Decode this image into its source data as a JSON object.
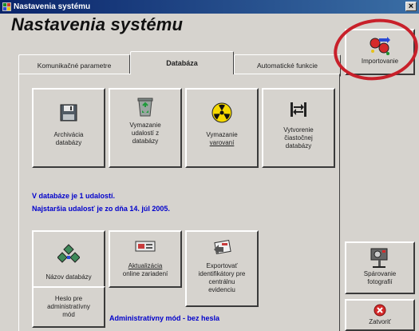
{
  "window": {
    "title": "Nastavenia systému",
    "heading": "Nastavenia systému",
    "close_glyph": "×"
  },
  "tabs": [
    {
      "label": "Komunikačné parametre",
      "active": false
    },
    {
      "label": "Databáza",
      "active": true
    },
    {
      "label": "Automatické funkcie",
      "active": false
    }
  ],
  "actions_top": [
    {
      "label_line1": "Archivácia",
      "label_line2": "databázy",
      "icon": "floppy-disk-icon"
    },
    {
      "label_line1": "Vymazanie",
      "label_line2": "udalostí z",
      "label_line3": "databázy",
      "icon": "recycle-bin-icon"
    },
    {
      "label_line1": "Vymazanie",
      "label_line2": "varovaní",
      "underline_index": 0,
      "icon": "radiation-icon"
    },
    {
      "label_line1": "Vytvorenie",
      "label_line2": "čiastočnej",
      "label_line3": "databázy",
      "icon": "arrows-exchange-icon"
    }
  ],
  "info": {
    "line1": "V databáze je 1 udalostí.",
    "line2": "Najstaršia udalosť je zo dňa 14. júl 2005."
  },
  "actions_bottom": [
    {
      "label": "Názov databázy",
      "icon": "network-icon"
    },
    {
      "label_line1": "Aktualizácia",
      "label_line2": "online zariadení",
      "icon": "device-update-icon"
    },
    {
      "label_line1": "Exportovať",
      "label_line2": "identifikátory pre",
      "label_line3": "centrálnu",
      "label_line4": "evidenciu",
      "icon": "export-identifiers-icon"
    }
  ],
  "admin_password": {
    "label_line1": "Heslo pre",
    "label_line2": "administratívny",
    "label_line3": "mód"
  },
  "admin_status": "Administratívny mód - bez hesla",
  "sidebar": {
    "import_label": "Importovanie",
    "photos_line1": "Spárovanie",
    "photos_line2": "fotografií",
    "close_label": "Zatvoriť"
  },
  "colors": {
    "accent_info": "#0000cc",
    "annotation_circle": "#c8202a",
    "window_bg": "#d6d3ce"
  }
}
